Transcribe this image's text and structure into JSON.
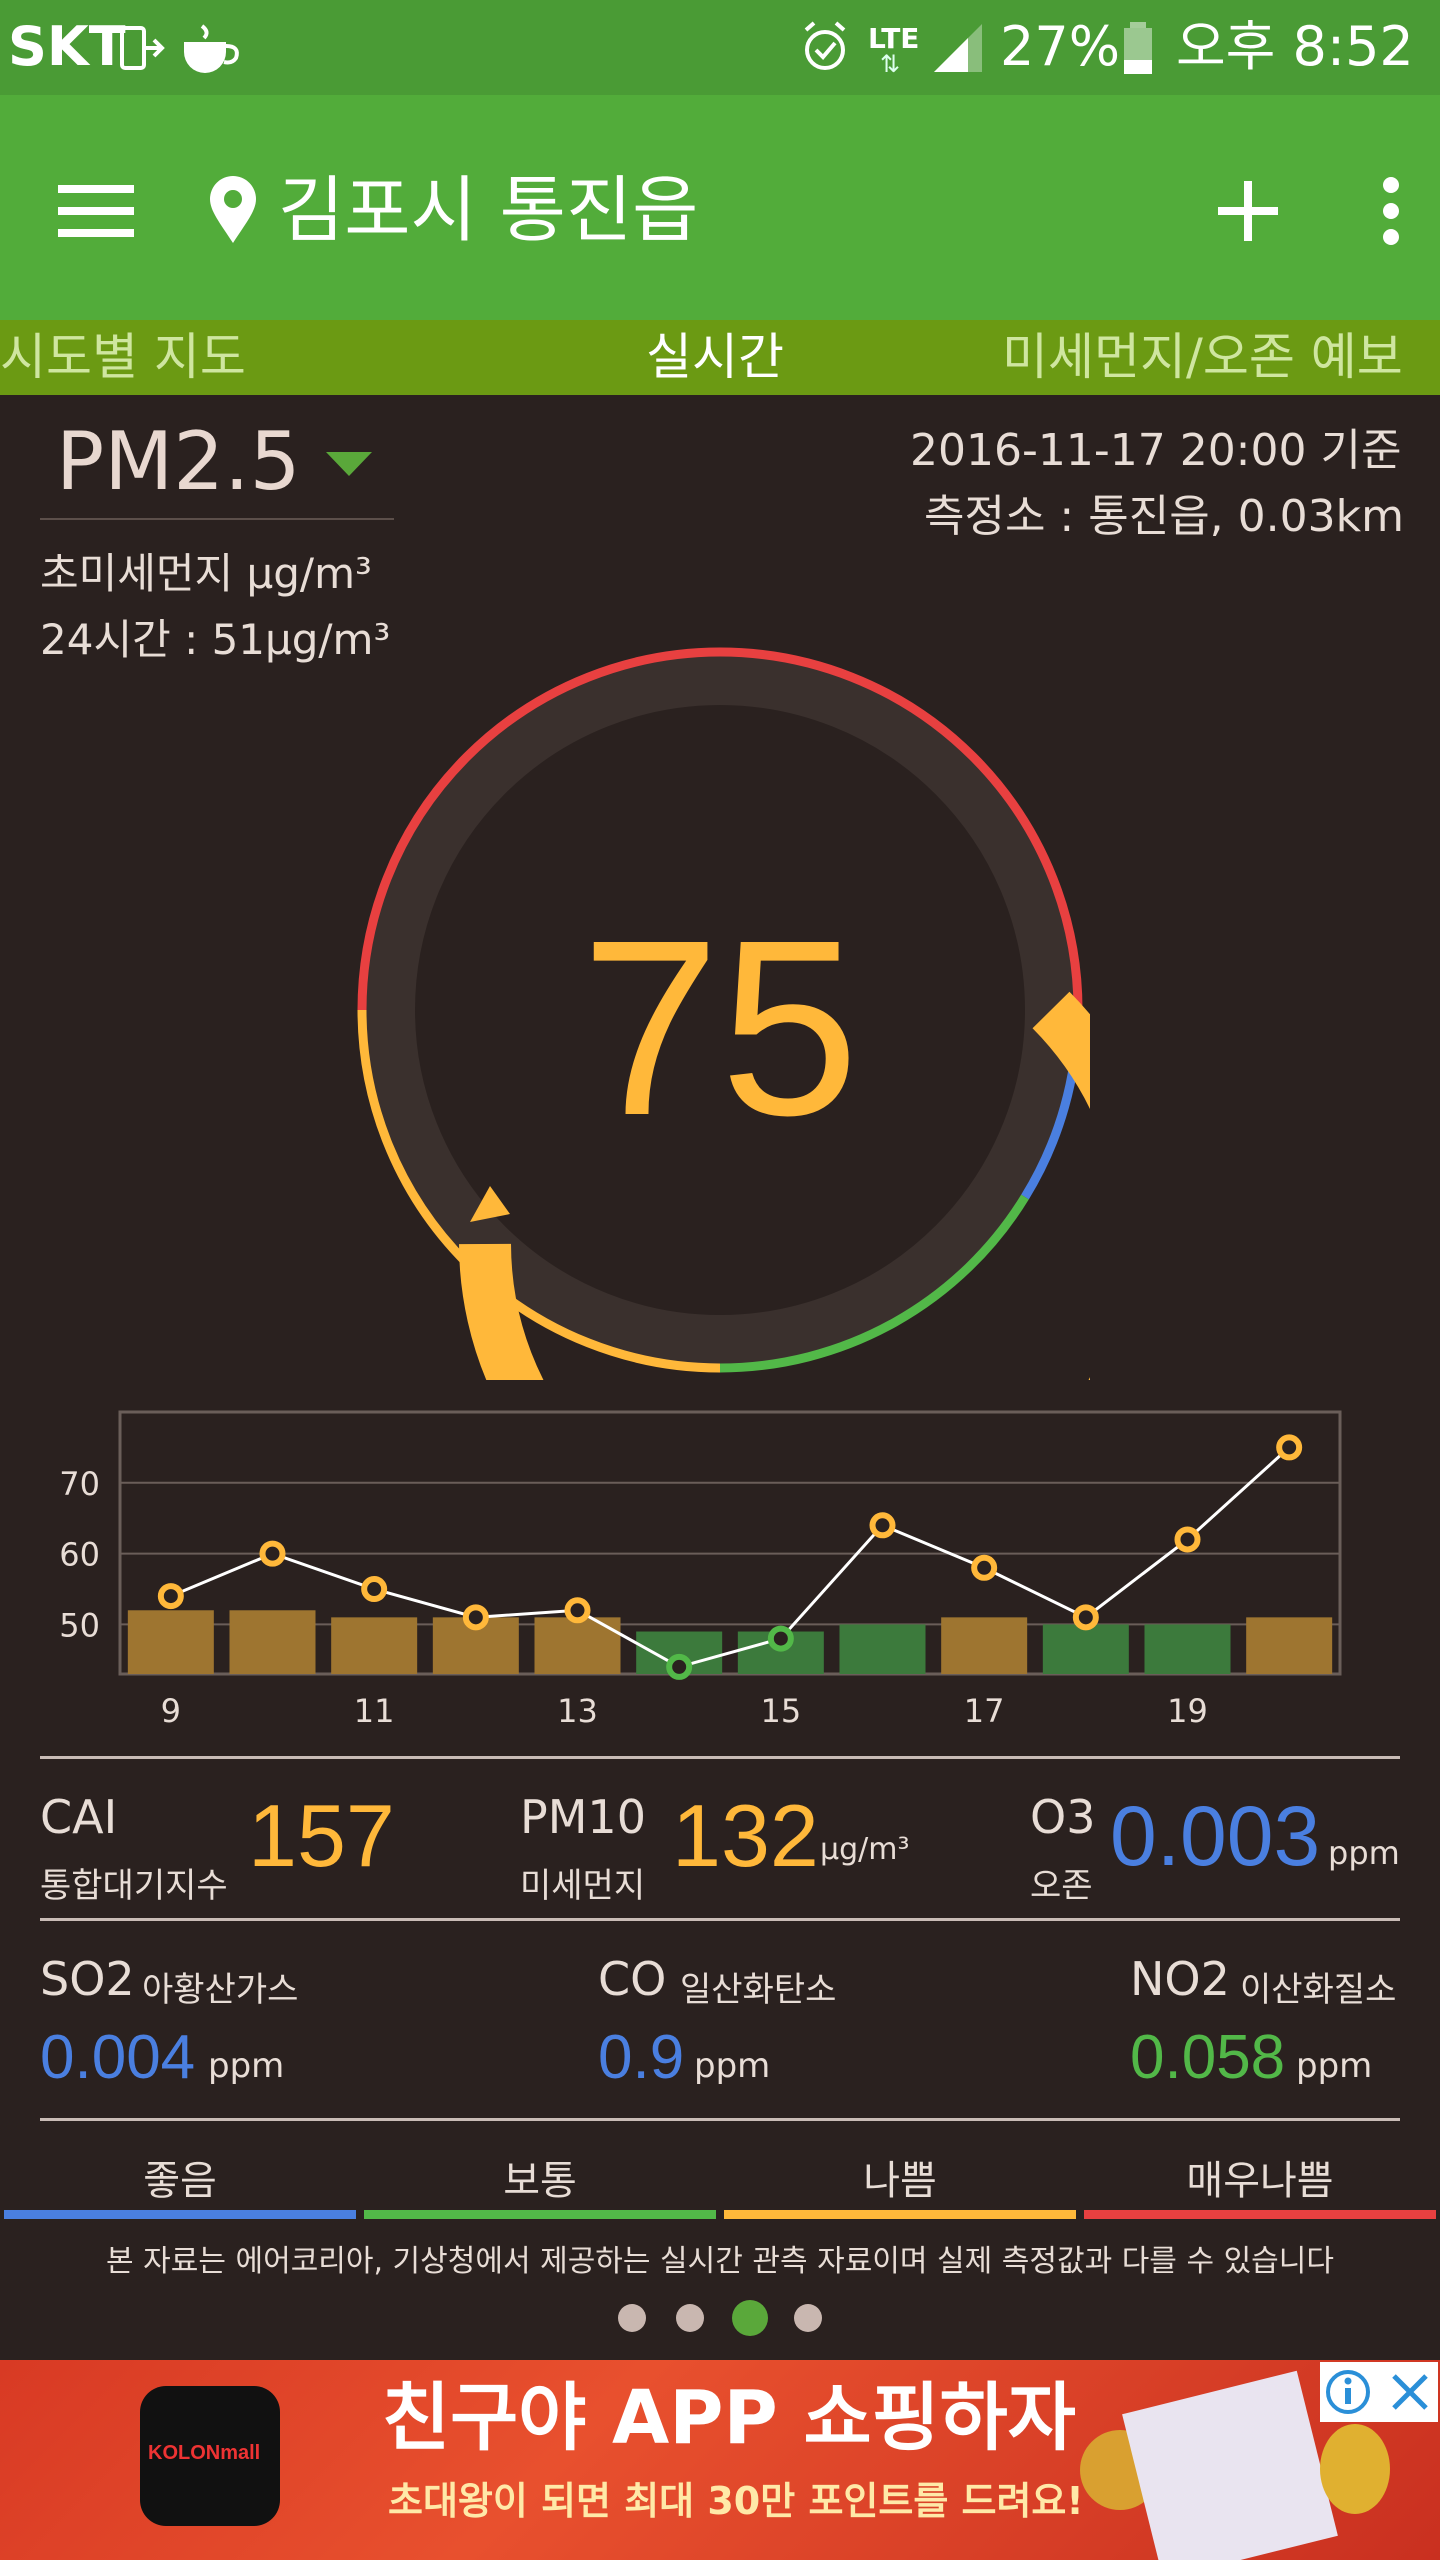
{
  "status_bar": {
    "carrier": "SKT",
    "network": "LTE",
    "battery": "27%",
    "time": "오후 8:52"
  },
  "app_bar": {
    "location": "김포시 통진읍",
    "icons": [
      "menu-icon",
      "location-pin-icon",
      "add-icon",
      "more-vert-icon"
    ]
  },
  "tabs": [
    {
      "label": "시도별 지도",
      "active": false
    },
    {
      "label": "실시간",
      "active": true
    },
    {
      "label": "미세먼지/오존 예보",
      "active": false
    }
  ],
  "header": {
    "pollutant": "PM2.5",
    "subtitle": "초미세먼지  μg/m³",
    "avg24": "24시간 :  51μg/m³",
    "datetime": "2016-11-17  20:00 기준",
    "station": "측정소 : 통진읍, 0.03km"
  },
  "gauge": {
    "value": "75",
    "numeric_value": 75,
    "colors": {
      "good": "#4a7fe0",
      "normal": "#52b848",
      "bad": "#ffb83a",
      "very_bad": "#e84040",
      "track": "#3a302d"
    }
  },
  "chart_data": {
    "type": "line",
    "x": [
      9,
      10,
      11,
      12,
      13,
      14,
      15,
      16,
      17,
      18,
      19,
      20
    ],
    "x_tick_labels": [
      "9",
      "11",
      "13",
      "15",
      "17",
      "19"
    ],
    "y_tick_labels": [
      "70",
      "60",
      "50"
    ],
    "ylim": [
      43,
      80
    ],
    "series": [
      {
        "values": [
          54,
          60,
          55,
          51,
          52,
          44,
          48,
          64,
          58,
          51,
          62,
          75
        ]
      }
    ],
    "bars": [
      52,
      52,
      51,
      51,
      51,
      49,
      49,
      50,
      51,
      50,
      50,
      51
    ],
    "bar_status": [
      "bad",
      "bad",
      "bad",
      "bad",
      "bad",
      "normal",
      "normal",
      "normal",
      "bad",
      "normal",
      "normal",
      "bad"
    ],
    "point_status": [
      "bad",
      "bad",
      "bad",
      "bad",
      "bad",
      "normal",
      "normal",
      "bad",
      "bad",
      "bad",
      "bad",
      "bad"
    ],
    "colors": {
      "bad_bar": "#9e7530",
      "normal_bar": "#3c7a3c",
      "bad_point": "#ffb83a",
      "normal_point": "#52b848"
    }
  },
  "indices": {
    "cai": {
      "name": "CAI",
      "sub": "통합대기지수",
      "value": "157"
    },
    "pm10": {
      "name": "PM10",
      "sub": "미세먼지",
      "value": "132",
      "unit": "μg/m³"
    },
    "o3": {
      "name": "O3",
      "sub": "오존",
      "value": "0.003",
      "unit": "ppm"
    },
    "so2": {
      "name": "SO2",
      "sub": "아황산가스",
      "value": "0.004",
      "unit": "ppm"
    },
    "co": {
      "name": "CO",
      "sub": "일산화탄소",
      "value": "0.9",
      "unit": "ppm"
    },
    "no2": {
      "name": "NO2",
      "sub": "이산화질소",
      "value": "0.058",
      "unit": "ppm"
    }
  },
  "legend": [
    {
      "label": "좋음",
      "color": "#4a7fe0"
    },
    {
      "label": "보통",
      "color": "#52b848"
    },
    {
      "label": "나쁨",
      "color": "#ffb83a"
    },
    {
      "label": "매우나쁨",
      "color": "#e84040"
    }
  ],
  "notice": "본 자료는 에어코리아, 기상청에서 제공하는 실시간 관측 자료이며 실제 측정값과 다를 수 있습니다",
  "pager": {
    "count": 4,
    "active": 3
  },
  "ad": {
    "brand": "KOLONmall",
    "headline": "친구야 APP 쇼핑하자",
    "subline": "초대왕이 되면 최대 30만 포인트를 드려요!"
  }
}
